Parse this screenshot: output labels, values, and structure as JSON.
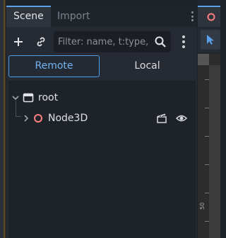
{
  "dock": {
    "tabs": [
      {
        "label": "Scene",
        "active": true
      },
      {
        "label": "Import",
        "active": false
      }
    ]
  },
  "toolbar": {
    "filter_placeholder": "Filter: name, t:type,"
  },
  "mode_toggle": {
    "remote_label": "Remote",
    "local_label": "Local",
    "selected": "Remote"
  },
  "tree": {
    "root": {
      "label": "root",
      "icon": "node-icon",
      "expanded": true
    },
    "children": [
      {
        "label": "Node3D",
        "icon": "node3d-icon",
        "expanded": false
      }
    ]
  },
  "viewport": {
    "ruler_label": "50"
  },
  "colors": {
    "accent": "#4d9ee5",
    "node3d": "#fc7f7f"
  }
}
